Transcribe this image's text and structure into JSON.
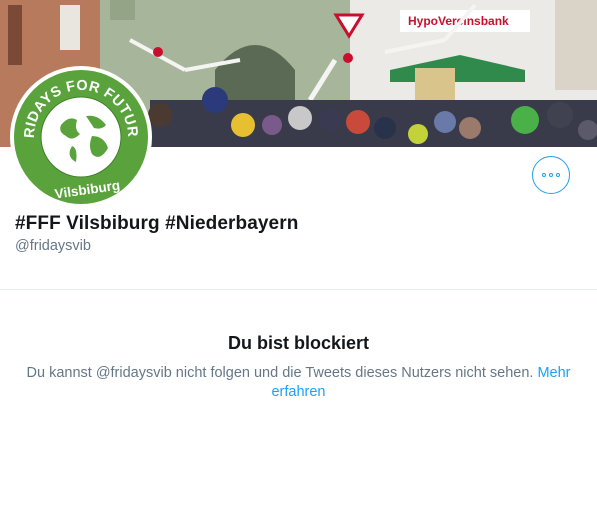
{
  "profile": {
    "display_name": "#FFF Vilsbiburg #Niederbayern",
    "handle": "@fridaysvib",
    "avatar": {
      "logo_text_top": "FRIDAYS FOR FUTURE",
      "logo_text_bottom": "Vilsbiburg",
      "bg_color": "#5aa33c"
    },
    "banner": {
      "sign_text": "HypoVereinsbank"
    }
  },
  "more_button": {
    "icon": "more-options-icon"
  },
  "blocked": {
    "title": "Du bist blockiert",
    "message": "Du kannst @fridaysvib nicht folgen und die Tweets dieses Nutzers nicht sehen.",
    "link_text": "Mehr erfahren"
  },
  "colors": {
    "accent": "#1da1f2",
    "muted": "#657786",
    "text": "#14171a"
  }
}
